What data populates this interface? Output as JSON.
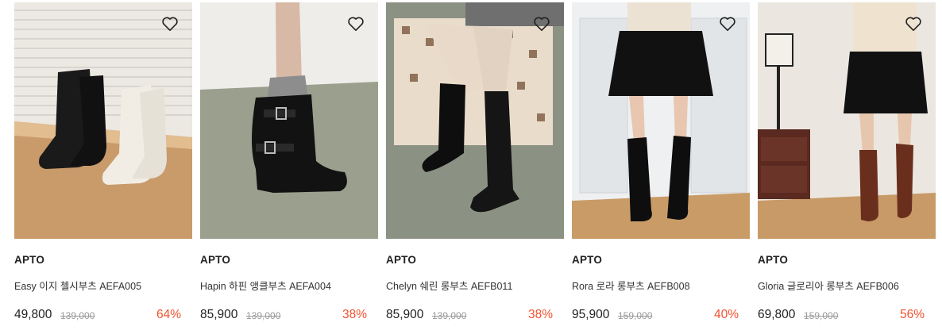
{
  "colors": {
    "discount": "#f2522e",
    "original_price": "#999999",
    "text": "#222222"
  },
  "products": [
    {
      "brand": "APTO",
      "name": "Easy 이지 첼시부츠 AEFA005",
      "price": "49,800",
      "original_price": "139,000",
      "discount": "64%",
      "wishlist_icon": "heart-outline-icon",
      "image_description_icon": "product-photo"
    },
    {
      "brand": "APTO",
      "name": "Hapin 하핀 앵클부츠 AEFA004",
      "price": "85,900",
      "original_price": "139,000",
      "discount": "38%",
      "wishlist_icon": "heart-outline-icon",
      "image_description_icon": "product-photo"
    },
    {
      "brand": "APTO",
      "name": "Chelyn 쉐린 롱부츠 AEFB011",
      "price": "85,900",
      "original_price": "139,000",
      "discount": "38%",
      "wishlist_icon": "heart-outline-icon",
      "image_description_icon": "product-photo"
    },
    {
      "brand": "APTO",
      "name": "Rora 로라 롱부츠 AEFB008",
      "price": "95,900",
      "original_price": "159,000",
      "discount": "40%",
      "wishlist_icon": "heart-outline-icon",
      "image_description_icon": "product-photo"
    },
    {
      "brand": "APTO",
      "name": "Gloria 글로리아 롱부츠 AEFB006",
      "price": "69,800",
      "original_price": "159,000",
      "discount": "56%",
      "wishlist_icon": "heart-outline-icon",
      "image_description_icon": "product-photo"
    }
  ]
}
